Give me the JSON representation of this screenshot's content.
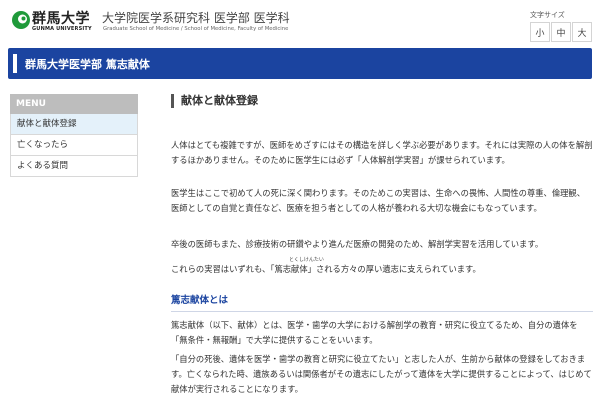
{
  "header": {
    "logo_jp": "群馬大学",
    "logo_en": "GUNMA UNIVERSITY",
    "site_title": "大学院医学系研究科 医学部 医学科",
    "site_subtitle": "Graduate School of Medicine / School of Medicine, Faculty of Medicine",
    "font_size_label": "文字サイズ",
    "font_sizes": [
      "小",
      "中",
      "大"
    ],
    "brand_color": "#1b44a0",
    "logo_color": "#1f9a3a"
  },
  "titlebar": {
    "text": "群馬大学医学部 篤志献体"
  },
  "sidebar": {
    "heading": "MENU",
    "items": [
      {
        "label": "献体と献体登録",
        "active": true
      },
      {
        "label": "亡くなったら",
        "active": false
      },
      {
        "label": "よくある質問",
        "active": false
      }
    ]
  },
  "main": {
    "heading": "献体と献体登録",
    "paragraphs": [
      "人体はとても複雑ですが、医師をめざすにはその構造を詳しく学ぶ必要があります。それには実際の人の体を解剖するほかありません。そのために医学生には必ず「人体解剖学実習」が課せられています。",
      "医学生はここで初めて人の死に深く関わります。そのためこの実習は、生命への畏怖、人間性の尊重、倫理観、医師としての自覚と責任など、医療を担う者としての人格が養われる大切な機会にもなっています。",
      "卒後の医師もまた、診療技術の研鑽やより進んだ医療の開発のため、解剖学実習を活用しています。",
      "これらの実習はいずれも、「篤志献体」される方々の厚い遺志に支えられています。"
    ],
    "ruby": "とくしけんたい",
    "section_heading": "篤志献体とは",
    "section_paragraphs": [
      "篤志献体（以下、献体）とは、医学・歯学の大学における解剖学の教育・研究に役立てるため、自分の遺体を「無条件・無報酬」で大学に提供することをいいます。",
      "「自分の死後、遺体を医学・歯学の教育と研究に役立てたい」と志した人が、生前から献体の登録をしておきます。亡くなられた時、遺族あるいは関係者がその遺志にしたがって遺体を大学に提供することによって、はじめて献体が実行されることになります。"
    ]
  }
}
